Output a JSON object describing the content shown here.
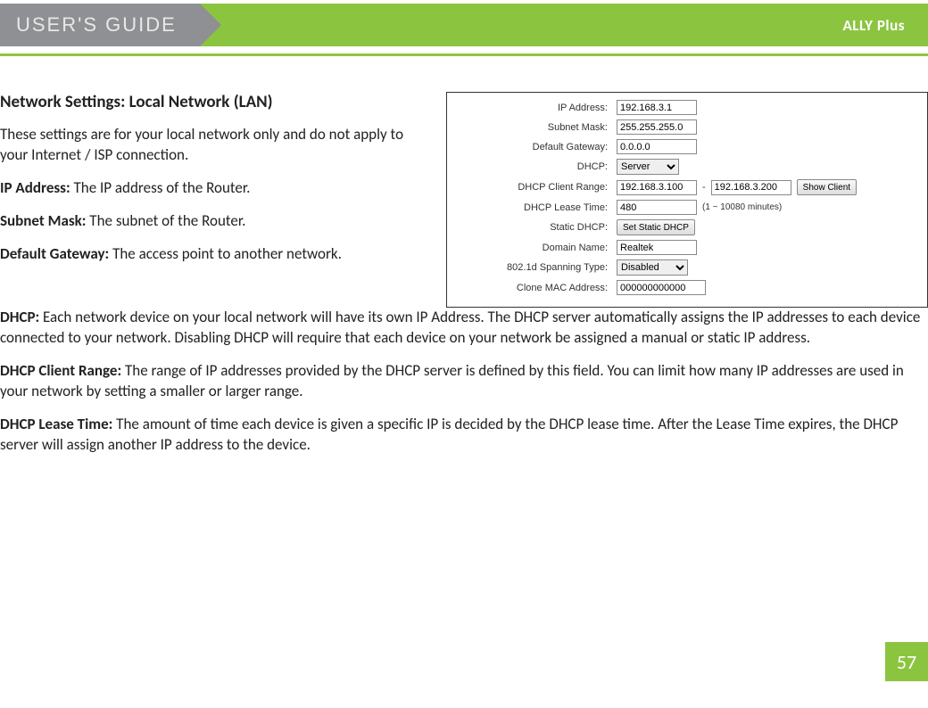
{
  "header": {
    "title": "USER'S GUIDE",
    "product": "ALLY Plus"
  },
  "section": {
    "title": "Network Settings: Local Network (LAN)",
    "intro": "These settings are for your local network only and do not apply to your Internet / ISP connection.",
    "ipaddr_label": "IP Address:",
    "ipaddr_text": " The IP address of the Router.",
    "subnet_label": "Subnet Mask:",
    "subnet_text": " The subnet of the Router.",
    "gateway_label": "Default Gateway:",
    "gateway_text": " The access point to another network.",
    "dhcp_label": "DHCP:",
    "dhcp_text": " Each network device on your local network will have its own IP Address.  The DHCP server automatically assigns the IP addresses to each device connected to your network.  Disabling DHCP will require that each device on your network be assigned a manual or static IP address.",
    "range_label": "DHCP Client Range:",
    "range_text": " The range of IP addresses provided by the DHCP server is defined by this field.  You can limit how many IP addresses are used in your network by setting a smaller or larger range.",
    "lease_label": "DHCP Lease Time:",
    "lease_text": " The amount of time each device is given a specific IP is decided by the DHCP lease time.  After the Lease Time expires, the DHCP server will assign another IP address to the device."
  },
  "panel": {
    "ip_label": "IP Address:",
    "ip_value": "192.168.3.1",
    "mask_label": "Subnet Mask:",
    "mask_value": "255.255.255.0",
    "gw_label": "Default Gateway:",
    "gw_value": "0.0.0.0",
    "dhcp_label": "DHCP:",
    "dhcp_selected": "Server",
    "range_label": "DHCP Client Range:",
    "range_start": "192.168.3.100",
    "range_dash": "-",
    "range_end": "192.168.3.200",
    "show_client_btn": "Show Client",
    "lease_label": "DHCP Lease Time:",
    "lease_value": "480",
    "lease_hint": "(1 ~ 10080 minutes)",
    "static_label": "Static DHCP:",
    "static_btn": "Set Static DHCP",
    "domain_label": "Domain Name:",
    "domain_value": "Realtek",
    "spanning_label": "802.1d Spanning Type:",
    "spanning_selected": "Disabled",
    "mac_label": "Clone MAC Address:",
    "mac_value": "000000000000"
  },
  "page_number": "57"
}
